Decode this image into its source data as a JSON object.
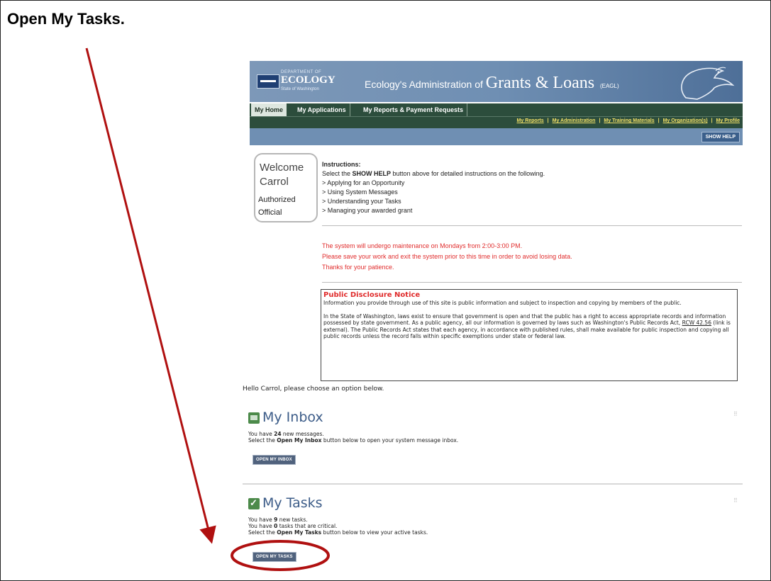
{
  "step": {
    "title": "Open My Tasks."
  },
  "banner": {
    "logo_dept": "DEPARTMENT OF",
    "logo_name": "ECOLOGY",
    "logo_state": "State of Washington",
    "title_prefix": "Ecology's Administration of",
    "title_main": "Grants & Loans",
    "title_abbr": "(EAGL)"
  },
  "nav": {
    "tabs": [
      {
        "label": "My Home"
      },
      {
        "label": "My Applications"
      },
      {
        "label": "My Reports & Payment Requests"
      }
    ],
    "links": [
      {
        "label": "My Reports"
      },
      {
        "label": "My Administration"
      },
      {
        "label": "My Training Materials"
      },
      {
        "label": "My Organization(s)"
      },
      {
        "label": "My Profile"
      }
    ],
    "show_help": "SHOW HELP"
  },
  "welcome": {
    "line1": "Welcome",
    "line2": "Carrol",
    "role1": "Authorized",
    "role2": "Official"
  },
  "instructions": {
    "heading": "Instructions:",
    "intro_pre": "Select the ",
    "intro_bold": "SHOW HELP",
    "intro_post": " button above for detailed instructions on the following.",
    "items": [
      "> Applying for an Opportunity",
      "> Using System Messages",
      "> Understanding your Tasks",
      "> Managing your awarded grant"
    ]
  },
  "maintenance": {
    "lines": [
      "The system will undergo maintenance on Mondays from 2:00-3:00 PM.",
      "Please save your work and exit the system prior to this time in order to avoid losing data.",
      "Thanks for your patience."
    ]
  },
  "notice": {
    "title": "Public Disclosure Notice",
    "p1": "Information you provide through use of this site is public information and subject to inspection and copying by members of the public.",
    "p2_pre": "In the State of Washington, laws exist to ensure that government is open and that the public has a right to access appropriate records and information possessed by state government. As a public agency, all our information is governed by laws such as Washington's Public Records Act, ",
    "p2_link": "RCW 42.56",
    "p2_post": " (link is external). The Public Records Act states that each agency, in accordance with published rules, shall make available for public inspection and copying all public records unless the record falls within specific exemptions under state or federal law."
  },
  "hello": "Hello Carrol, please choose an option below.",
  "inbox": {
    "title": "My Inbox",
    "line1_pre": "You have ",
    "count": "24",
    "line1_post": " new messages.",
    "line2_pre": "Select the ",
    "line2_bold": "Open My Inbox",
    "line2_post": " button below to open your system message inbox.",
    "button": "OPEN MY INBOX"
  },
  "tasks": {
    "title": "My Tasks",
    "line1_pre": "You have ",
    "count": "9",
    "line1_post": " new tasks.",
    "line2_pre": "You have ",
    "critical": "0",
    "line2_post": " tasks that are critical.",
    "line3_pre": "Select the ",
    "line3_bold": "Open My Tasks",
    "line3_post": " button below to view your active tasks.",
    "button": "OPEN MY TASKS"
  },
  "colors": {
    "annotation": "#b01010",
    "banner": "#6f8fb3",
    "nav": "#2c4d3c",
    "section_title": "#3c5c88"
  }
}
